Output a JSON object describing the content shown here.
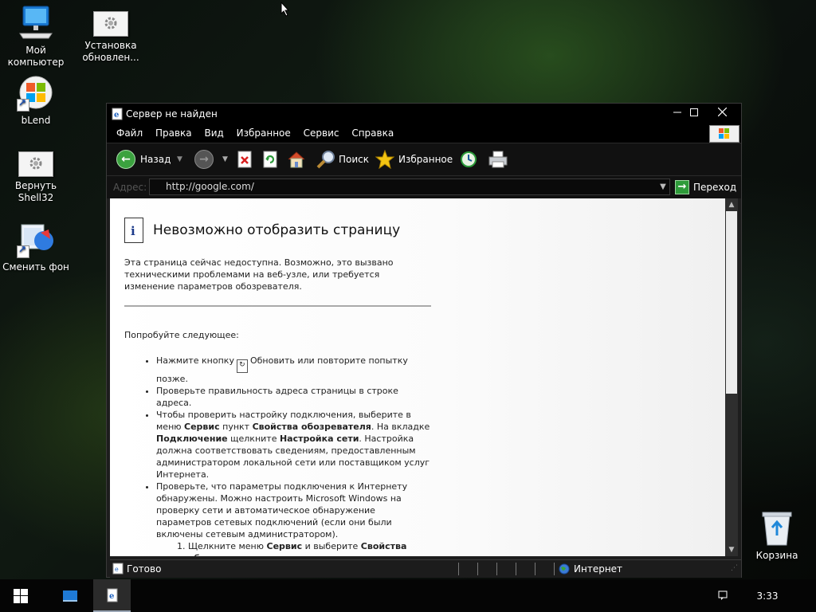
{
  "desktop": {
    "icons": [
      {
        "label": "Мой компьютер",
        "icon": "computer-icon"
      },
      {
        "label": "Установка обновлен...",
        "icon": "settings-file-icon"
      },
      {
        "label": "bLend",
        "icon": "windows-logo-shortcut-icon"
      },
      {
        "label": "Вернуть Shell32",
        "icon": "settings-file-icon"
      },
      {
        "label": "Сменить фон",
        "icon": "wallpaper-shortcut-icon"
      },
      {
        "label": "Корзина",
        "icon": "recycle-bin-icon"
      }
    ]
  },
  "window": {
    "title": "Сервер не найден",
    "menu": [
      "Файл",
      "Правка",
      "Вид",
      "Избранное",
      "Сервис",
      "Справка"
    ],
    "toolbar": {
      "back": "Назад",
      "search": "Поиск",
      "favorites": "Избранное"
    },
    "address": {
      "label": "Адрес:",
      "value": "http://google.com/",
      "go": "Переход"
    },
    "page": {
      "heading": "Невозможно отобразить страницу",
      "intro": "Эта страница сейчас недоступна. Возможно, это вызвано техническими проблемами на веб-узле, или требуется изменение параметров обозревателя.",
      "try_label": "Попробуйте следующее:",
      "tip1_before": "Нажмите кнопку",
      "tip1_after": "Обновить или повторите попытку позже.",
      "tip2": "Проверьте правильность адреса страницы в строке адреса.",
      "tip3_a": "Чтобы проверить настройку подключения, выберите в меню ",
      "tip3_b": "Сервис",
      "tip3_c": " пункт ",
      "tip3_d": "Свойства обозревателя",
      "tip3_e": ". На вкладке ",
      "tip3_f": "Подключение",
      "tip3_g": " щелкните ",
      "tip3_h": "Настройка сети",
      "tip3_i": ". Настройка должна соответствовать сведениям, предоставленным администратором локальной сети или поставщиком услуг Интернета.",
      "tip4": "Проверьте, что параметры подключения к Интернету обнаружены. Можно настроить Microsoft Windows на проверку сети и автоматическое обнаружение параметров сетевых подключений (если они были включены сетевым администратором).",
      "step1_a": "Щелкните меню ",
      "step1_b": "Сервис",
      "step1_c": " и выберите ",
      "step1_d": "Свойства обозревателя"
    },
    "status": {
      "text": "Готово",
      "zone": "Интернет"
    }
  },
  "taskbar": {
    "clock": "3:33"
  },
  "colors": {
    "desktop_bg": "#0b100d",
    "window_chrome": "#000000",
    "toolbar_bg": "#111111",
    "content_bg": "#ffffff"
  }
}
